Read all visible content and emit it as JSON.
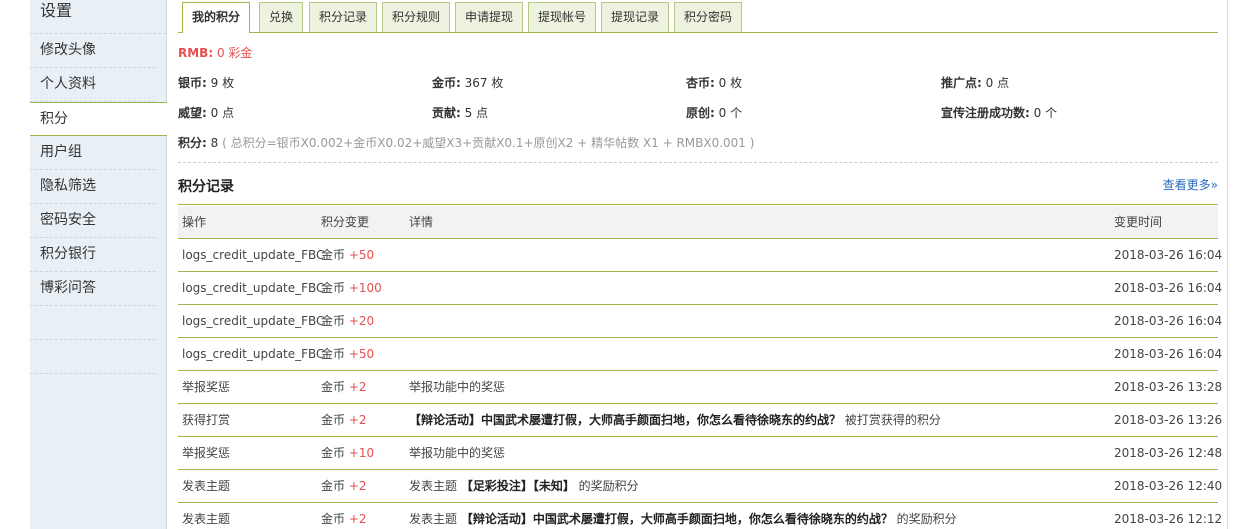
{
  "sidebar": {
    "title": "设置",
    "items": [
      {
        "label": "修改头像",
        "active": false
      },
      {
        "label": "个人资料",
        "active": false
      },
      {
        "label": "积分",
        "active": true
      },
      {
        "label": "用户组",
        "active": false
      },
      {
        "label": "隐私筛选",
        "active": false
      },
      {
        "label": "密码安全",
        "active": false
      },
      {
        "label": "积分银行",
        "active": false
      },
      {
        "label": "博彩问答",
        "active": false
      }
    ]
  },
  "tabs": [
    "我的积分",
    "兑换",
    "积分记录",
    "积分规则",
    "申请提现",
    "提现帐号",
    "提现记录",
    "积分密码"
  ],
  "summary": {
    "rmb_label": "RMB:",
    "rmb_value": "0 彩金",
    "row1": [
      {
        "label": "银币:",
        "value": "9 枚"
      },
      {
        "label": "金币:",
        "value": "367 枚"
      },
      {
        "label": "杏币:",
        "value": "0 枚"
      },
      {
        "label": "推广点:",
        "value": "0 点"
      }
    ],
    "row2": [
      {
        "label": "威望:",
        "value": "0 点"
      },
      {
        "label": "贡献:",
        "value": "5 点"
      },
      {
        "label": "原创:",
        "value": "0 个"
      },
      {
        "label": "宣传注册成功数:",
        "value": "0 个"
      }
    ],
    "credit_label": "积分:",
    "credit_value": "8",
    "formula": "( 总积分=银币X0.002+金币X0.02+威望X3+贡献X0.1+原创X2 + 精华帖数 X1 + RMBX0.001 )"
  },
  "records": {
    "title": "积分记录",
    "more": "查看更多»",
    "columns": [
      "操作",
      "积分变更",
      "详情",
      "变更时间"
    ],
    "rows": [
      {
        "op": "logs_credit_update_FBC",
        "currency": "金币",
        "change": "+50",
        "detail": [],
        "time": "2018-03-26 16:04"
      },
      {
        "op": "logs_credit_update_FBC",
        "currency": "金币",
        "change": "+100",
        "detail": [],
        "time": "2018-03-26 16:04"
      },
      {
        "op": "logs_credit_update_FBC",
        "currency": "金币",
        "change": "+20",
        "detail": [],
        "time": "2018-03-26 16:04"
      },
      {
        "op": "logs_credit_update_FBC",
        "currency": "金币",
        "change": "+50",
        "detail": [],
        "time": "2018-03-26 16:04"
      },
      {
        "op": "举报奖惩",
        "currency": "金币",
        "change": "+2",
        "detail": [
          {
            "t": "举报功能中的奖惩",
            "b": false
          }
        ],
        "time": "2018-03-26 13:28"
      },
      {
        "op": "获得打赏",
        "currency": "金币",
        "change": "+2",
        "detail": [
          {
            "t": "【辩论活动】中国武术屡遭打假，大师高手颜面扫地，你怎么看待徐晓东的约战？",
            "b": true
          },
          {
            "t": " 被打赏获得的积分",
            "b": false
          }
        ],
        "time": "2018-03-26 13:26"
      },
      {
        "op": "举报奖惩",
        "currency": "金币",
        "change": "+10",
        "detail": [
          {
            "t": "举报功能中的奖惩",
            "b": false
          }
        ],
        "time": "2018-03-26 12:48"
      },
      {
        "op": "发表主题",
        "currency": "金币",
        "change": "+2",
        "detail": [
          {
            "t": "发表主题 ",
            "b": false
          },
          {
            "t": "【足彩投注】【未知】",
            "b": true
          },
          {
            "t": " 的奖励积分",
            "b": false
          }
        ],
        "time": "2018-03-26 12:40"
      },
      {
        "op": "发表主题",
        "currency": "金币",
        "change": "+2",
        "detail": [
          {
            "t": "发表主题 ",
            "b": false
          },
          {
            "t": "【辩论活动】中国武术屡遭打假，大师高手颜面扫地，你怎么看待徐晓东的约战？",
            "b": true
          },
          {
            "t": " 的奖励积分",
            "b": false
          }
        ],
        "time": "2018-03-26 12:12"
      }
    ]
  },
  "colors": {
    "accent_line": "#9fb84a",
    "plus": "#e6504f",
    "link": "#2a6ac0",
    "sidebar_bg": "#e8eff5"
  }
}
